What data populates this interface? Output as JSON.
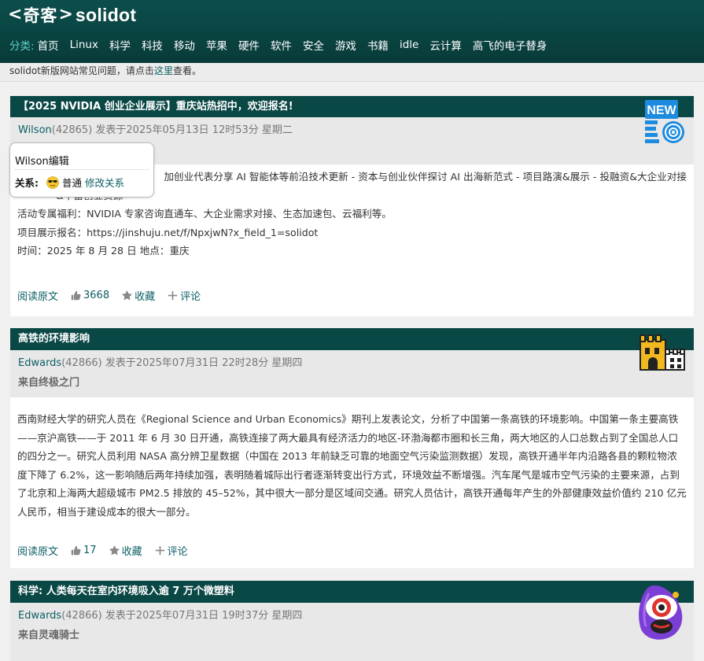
{
  "site": {
    "logo_cn": "奇客",
    "logo_en": "solidot",
    "nav_label": "分类:",
    "nav_items": [
      "首页",
      "Linux",
      "科学",
      "科技",
      "移动",
      "苹果",
      "硬件",
      "软件",
      "安全",
      "游戏",
      "书籍",
      "idle",
      "云计算",
      "高飞的电子替身"
    ],
    "notice_prefix": "solidot新版网站常见问题，请点击",
    "notice_link": "这里",
    "notice_suffix": "查看。"
  },
  "articles": [
    {
      "title": "【2025 NVIDIA 创业企业展示】重庆站热招中，欢迎报名!",
      "author": "Wilson",
      "meta": "(42865) 发表于2025年05月13日 12时53分 星期二",
      "source": "",
      "body": [
        "加创业代表分享 AI 智能体等前沿技术更新  - 资本与创业伙伴探讨 AI 出海新范式 - 项目路演&展示 - 投融资&大企业对接&丰富创业资源",
        "活动专属福利：NVIDIA 专家咨询直通车、大企业需求对接、生态加速包、云福利等。",
        "项目展示报名：https://jinshuju.net/f/NpxjwN?x_field_1=solidot",
        "时间：2025 年 8 月 28 日  地点：重庆"
      ],
      "read_label": "阅读原文",
      "likes": "3668",
      "fav_label": "收藏",
      "comment_label": "评论",
      "topic_icon": "new-badge-icon"
    },
    {
      "title": "高铁的环境影响",
      "author": "Edwards",
      "meta": "(42866) 发表于2025年07月31日 22时28分 星期四",
      "source": "来自终极之门",
      "body": [
        "西南财经大学的研究人员在《Regional Science and Urban Economics》期刊上发表论文，分析了中国第一条高铁的环境影响。中国第一条主要高铁——京沪高铁——于 2011 年 6 月 30 日开通，高铁连接了两大最具有经济活力的地区-环渤海都市圈和长三角，两大地区的人口总数占到了全国总人口的四分之一。研究人员利用 NASA 高分辨卫星数据（中国在 2013 年前缺乏可靠的地面空气污染监测数据）发现，高铁开通半年内沿路各县的颗粒物浓度下降了 6.2%，这一影响随后两年持续加强，表明随着城际出行者逐渐转变出行方式，环境效益不断增强。汽车尾气是城市空气污染的主要来源，占到了北京和上海两大超级城市 PM2.5 排放的 45–52%，其中很大一部分是区域间交通。研究人员估计，高铁开通每年产生的外部健康效益价值约 210 亿元人民币，相当于建设成本的很大一部分。"
      ],
      "read_label": "阅读原文",
      "likes": "17",
      "fav_label": "收藏",
      "comment_label": "评论",
      "topic_icon": "castle-icon"
    },
    {
      "title": "科学: 人类每天在室内环境吸入逾 7 万个微塑料",
      "author": "Edwards",
      "meta": "(42866) 发表于2025年07月31日 19时37分 星期四",
      "source": "来自灵魂骑士",
      "topic_icon": "science-mascot-icon"
    }
  ],
  "popover": {
    "title": "Wilson编辑",
    "relation_label": "关系:",
    "relation_value": "普通",
    "relation_link": "修改关系"
  },
  "colors": {
    "header": "#0a4846",
    "link": "#0b5e64",
    "nav_label": "#5fd3c9"
  }
}
